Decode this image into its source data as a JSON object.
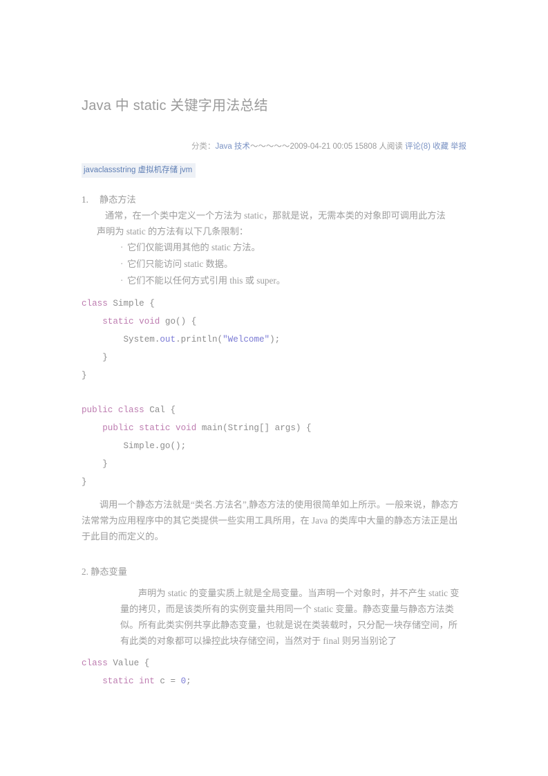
{
  "article": {
    "title": "Java 中 static 关键字用法总结",
    "meta": {
      "category_label": "分类：",
      "category_link": "Java 技术",
      "wave": "～～～～～",
      "date": "2009-04-21 00:05",
      "reads": "15808 人阅读",
      "comments": "评论(8)",
      "favorite": "收藏",
      "report": "举报"
    },
    "tags": {
      "tag1": "javaclassstring",
      "tag2": "虚拟机存储",
      "tag3": "jvm"
    },
    "section1": {
      "number": "1.",
      "heading": "静态方法",
      "p1": "通常，在一个类中定义一个方法为 static，那就是说，无需本类的对象即可调用此方法",
      "p2": "声明为 static 的方法有以下几条限制：",
      "bullets": {
        "b1": "它们仅能调用其他的 static 方法。",
        "b2": "它们只能访问 static 数据。",
        "b3": "它们不能以任何方式引用 this 或 super。"
      },
      "code1": {
        "l1_kw": "class",
        "l1_rest": " Simple {",
        "l2_indent": "    ",
        "l2_kw": "static void",
        "l2_rest": " go() {",
        "l3_indent": "        ",
        "l3_a": "System.",
        "l3_prop": "out",
        "l3_b": ".println(",
        "l3_str": "\"Welcome\"",
        "l3_c": ");",
        "l4": "    }",
        "l5": "}"
      },
      "code2": {
        "l1_kw": "public class",
        "l1_rest": " Cal {",
        "l2_indent": "    ",
        "l2_kw": "public static void",
        "l2_rest": " main(String[] args) {",
        "l3": "        Simple.go();",
        "l4": "    }",
        "l5": "}"
      },
      "p3": "调用一个静态方法就是“类名.方法名”,静态方法的使用很简单如上所示。一般来说，静态方法常常为应用程序中的其它类提供一些实用工具所用，在 Java 的类库中大量的静态方法正是出于此目的而定义的。"
    },
    "section2": {
      "heading": "2. 静态变量",
      "p1": "声明为 static 的变量实质上就是全局变量。当声明一个对象时，并不产生 static 变量的拷贝，而是该类所有的实例变量共用同一个 static 变量。静态变量与静态方法类似。所有此类实例共享此静态变量，也就是说在类装载时，只分配一块存储空间，所有此类的对象都可以操控此块存储空间，当然对于 final 则另当别论了",
      "code3": {
        "l1_kw": "class",
        "l1_rest": " Value {",
        "l2_indent": "    ",
        "l2_kw": "static int",
        "l2_mid": " c = ",
        "l2_num": "0",
        "l2_end": ";"
      }
    }
  }
}
